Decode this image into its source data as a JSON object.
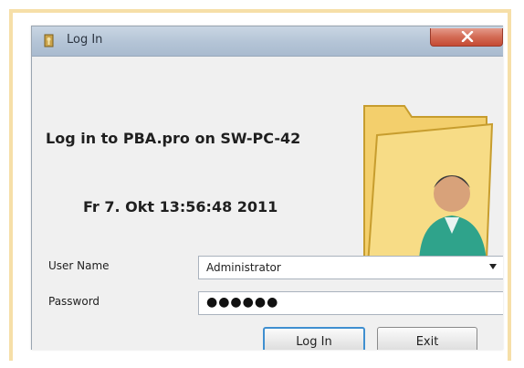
{
  "window": {
    "title": "Log In",
    "heading": "Log in to PBA.pro on SW-PC-42",
    "datetime": "Fr 7. Okt 13:56:48 2011"
  },
  "form": {
    "username_label": "User Name",
    "username_value": "Administrator",
    "password_label": "Password",
    "password_value": "●●●●●●"
  },
  "buttons": {
    "login": "Log In",
    "exit": "Exit"
  },
  "icons": {
    "app": "key-icon",
    "close": "close-icon",
    "illustration": "user-folder-icon"
  },
  "colors": {
    "frame": "#f6dfa8",
    "titlebar": "#b4c4d6",
    "close": "#d36b55",
    "dialog_bg": "#f0f0f0",
    "focus": "#3f8fd0"
  }
}
